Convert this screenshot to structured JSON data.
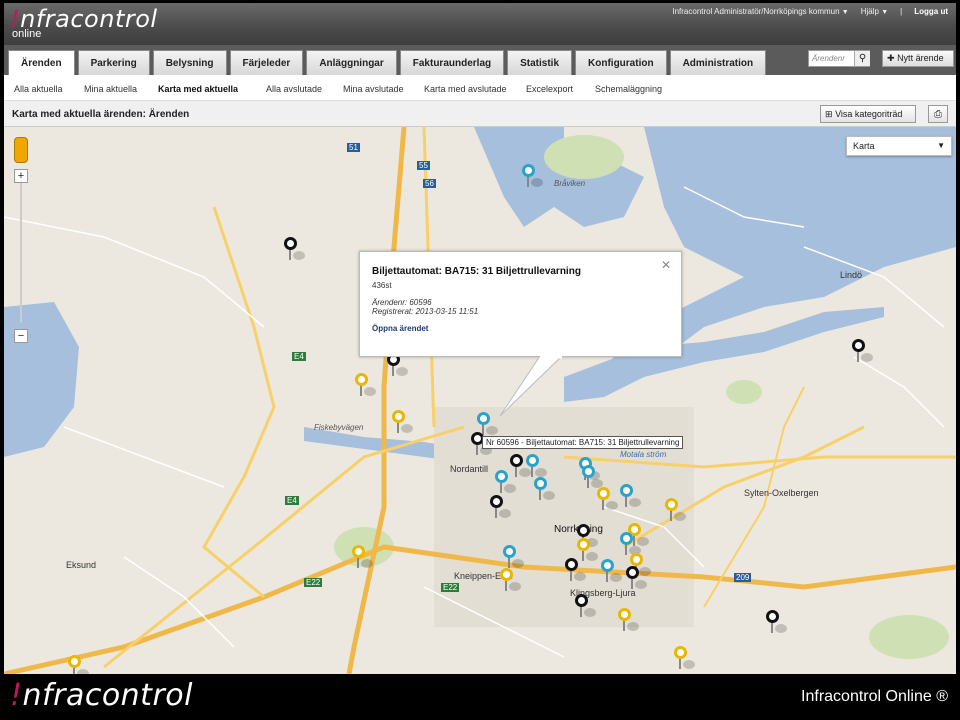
{
  "header": {
    "logo_prefix": "!",
    "logo_text": "nfracontrol",
    "logo_sub": "online",
    "user": "Infracontrol Administratör/Norrköpings kommun",
    "help": "Hjälp",
    "logout": "Logga ut"
  },
  "tabs": [
    {
      "label": "Ärenden"
    },
    {
      "label": "Parkering"
    },
    {
      "label": "Belysning"
    },
    {
      "label": "Färjeleder"
    },
    {
      "label": "Anläggningar"
    },
    {
      "label": "Fakturaunderlag"
    },
    {
      "label": "Statistik"
    },
    {
      "label": "Konfiguration"
    },
    {
      "label": "Administration"
    }
  ],
  "search": {
    "placeholder": "Ärendenr"
  },
  "new_case": "Nytt ärende",
  "subnav": [
    {
      "label": "Alla aktuella"
    },
    {
      "label": "Mina aktuella"
    },
    {
      "label": "Karta med aktuella"
    },
    {
      "label": "Alla avslutade"
    },
    {
      "label": "Mina avslutade"
    },
    {
      "label": "Karta med avslutade"
    },
    {
      "label": "Excelexport"
    },
    {
      "label": "Schemaläggning"
    }
  ],
  "page_title": "Karta med aktuella ärenden: Ärenden",
  "category_button": "Visa kategoriträd",
  "map": {
    "type_select": "Karta",
    "labels": {
      "braviken": "Bråviken",
      "norrkoping": "Norrköping",
      "nordantill": "Nordantill",
      "lindo": "Lindö",
      "sylten": "Sylten-Oxelbergen",
      "eksund": "Eksund",
      "kneippen": "Kneippen-Ekte",
      "klingsberg": "Klingsberg-Ljura",
      "motala": "Motala ström",
      "fiskeby": "Fiskebyvägen",
      "e4": "E4",
      "e22": "E22",
      "r51": "51",
      "r55": "55",
      "r56": "56",
      "r209": "209"
    },
    "popup": {
      "title": "Biljettautomat: BA715: 31 Biljettrullevarning",
      "count": "436st",
      "case_no": "Ärendenr: 60596",
      "registered": "Registrerat: 2013-03-15 11:51",
      "open_link": "Öppna ärendet"
    },
    "tooltip": "Nr 60596 - Biljettautomat: BA715: 31 Biljettrullevarning",
    "colors": {
      "yellow": "#e8b800",
      "blue": "#29a3c9",
      "black": "#111111"
    }
  },
  "footer": {
    "logo_prefix": "!",
    "logo_text": "nfracontrol",
    "product": "Infracontrol Online ®"
  }
}
